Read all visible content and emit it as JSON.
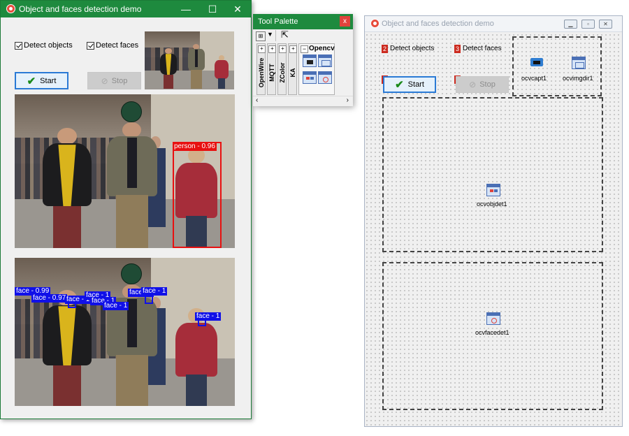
{
  "running_window": {
    "title": "Object and faces detection demo",
    "caption_minimize": "—",
    "caption_maximize": "☐",
    "caption_close": "✕",
    "detect_objects_label": "Detect objects",
    "detect_objects_checked": true,
    "detect_faces_label": "Detect faces",
    "detect_faces_checked": true,
    "start_label": "Start",
    "stop_label": "Stop",
    "object_detections": [
      {
        "label": "person - 0.96"
      }
    ],
    "face_detections": [
      {
        "label": "face - 0.99"
      },
      {
        "label": "face - 0.97"
      },
      {
        "label": "face - 1"
      },
      {
        "label": "face - 1"
      },
      {
        "label": "face - 1"
      },
      {
        "label": "face - 1"
      },
      {
        "label": "face - 1"
      },
      {
        "label": "face - 1"
      },
      {
        "label": "face - 1"
      }
    ],
    "colors": {
      "titlebar": "#1e8a3e",
      "object_box": "#e81010",
      "face_box": "#1010e8"
    }
  },
  "tool_palette": {
    "title": "Tool Palette",
    "close_glyph": "x",
    "tabs": [
      "OpenWire",
      "MQTT",
      "ZColor",
      "KA"
    ],
    "open_category": "Opencv",
    "pointer_tool": "pointer-icon"
  },
  "design_form": {
    "title": "Object and faces detection demo",
    "detect_objects_label": "Detect objects",
    "detect_objects_order": "2",
    "detect_faces_label": "Detect faces",
    "detect_faces_order": "3",
    "start_label": "Start",
    "start_order": "0",
    "stop_label": "Stop",
    "stop_order": "1",
    "components": {
      "capture": "ocvcapt1",
      "image_display": "ocvimgdir1",
      "object_detector": "ocvobjdet1",
      "face_detector": "ocvfacedet1"
    }
  }
}
